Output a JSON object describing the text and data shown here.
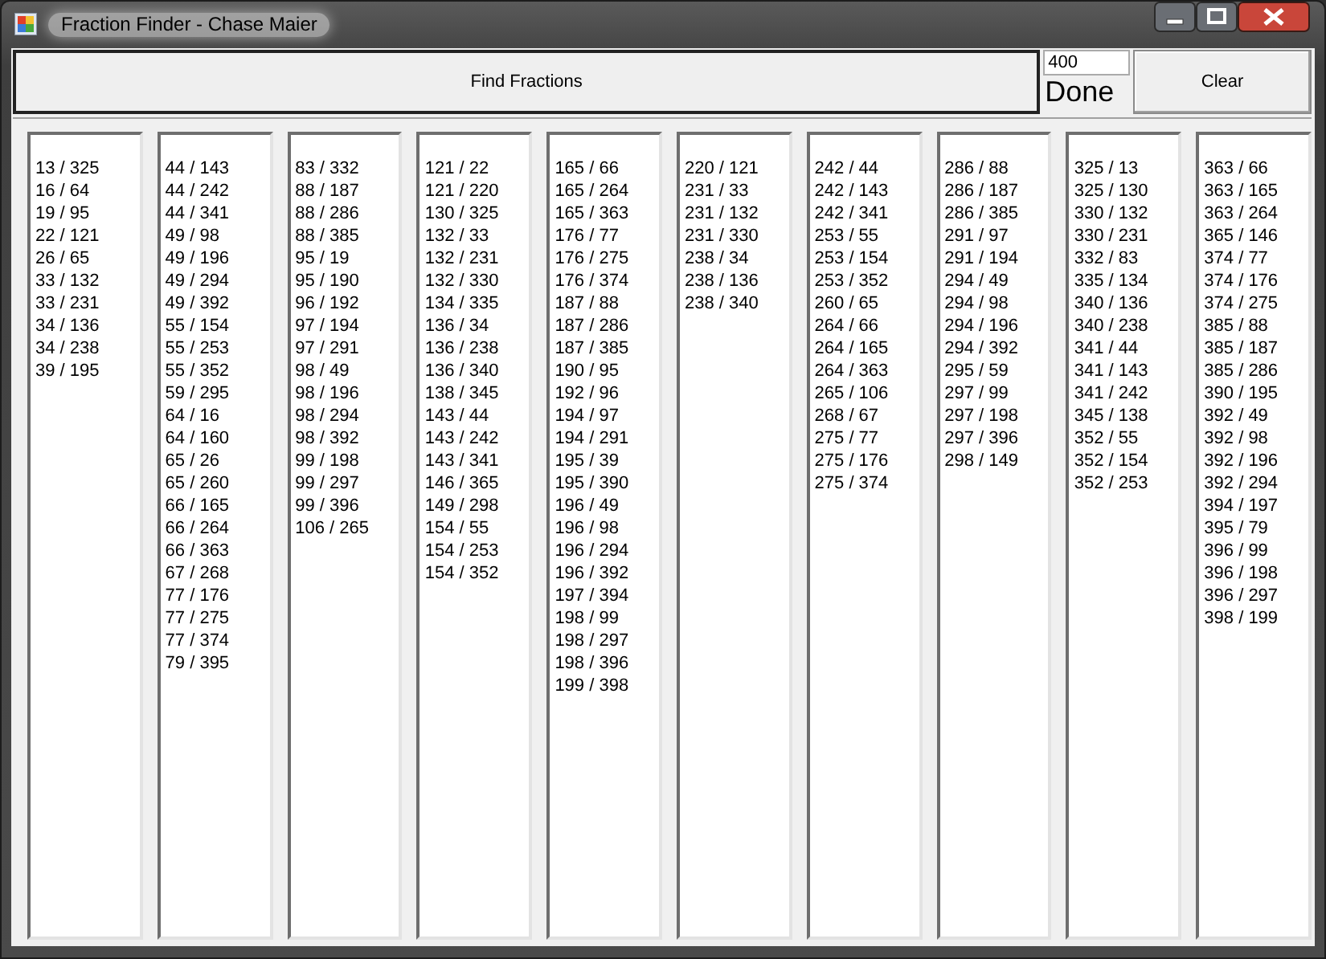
{
  "window": {
    "title": "Fraction Finder - Chase Maier"
  },
  "find_button": "Find Fractions",
  "limit_field": {
    "value": "400"
  },
  "status": "Done",
  "clear_button": "Clear",
  "lists": [
    [
      "13 / 325",
      "16 / 64",
      "19 / 95",
      "22 / 121",
      "26 / 65",
      "33 / 132",
      "33 / 231",
      "34 / 136",
      "34 / 238",
      "39 / 195"
    ],
    [
      "44 / 143",
      "44 / 242",
      "44 / 341",
      "49 / 98",
      "49 / 196",
      "49 / 294",
      "49 / 392",
      "55 / 154",
      "55 / 253",
      "55 / 352",
      "59 / 295",
      "64 / 16",
      "64 / 160",
      "65 / 26",
      "65 / 260",
      "66 / 165",
      "66 / 264",
      "66 / 363",
      "67 / 268",
      "77 / 176",
      "77 / 275",
      "77 / 374",
      "79 / 395"
    ],
    [
      "83 / 332",
      "88 / 187",
      "88 / 286",
      "88 / 385",
      "95 / 19",
      "95 / 190",
      "96 / 192",
      "97 / 194",
      "97 / 291",
      "98 / 49",
      "98 / 196",
      "98 / 294",
      "98 / 392",
      "99 / 198",
      "99 / 297",
      "99 / 396",
      "106 / 265"
    ],
    [
      "121 / 22",
      "121 / 220",
      "130 / 325",
      "132 / 33",
      "132 / 231",
      "132 / 330",
      "134 / 335",
      "136 / 34",
      "136 / 238",
      "136 / 340",
      "138 / 345",
      "143 / 44",
      "143 / 242",
      "143 / 341",
      "146 / 365",
      "149 / 298",
      "154 / 55",
      "154 / 253",
      "154 / 352"
    ],
    [
      "165 / 66",
      "165 / 264",
      "165 / 363",
      "176 / 77",
      "176 / 275",
      "176 / 374",
      "187 / 88",
      "187 / 286",
      "187 / 385",
      "190 / 95",
      "192 / 96",
      "194 / 97",
      "194 / 291",
      "195 / 39",
      "195 / 390",
      "196 / 49",
      "196 / 98",
      "196 / 294",
      "196 / 392",
      "197 / 394",
      "198 / 99",
      "198 / 297",
      "198 / 396",
      "199 / 398"
    ],
    [
      "220 / 121",
      "231 / 33",
      "231 / 132",
      "231 / 330",
      "238 / 34",
      "238 / 136",
      "238 / 340"
    ],
    [
      "242 / 44",
      "242 / 143",
      "242 / 341",
      "253 / 55",
      "253 / 154",
      "253 / 352",
      "260 / 65",
      "264 / 66",
      "264 / 165",
      "264 / 363",
      "265 / 106",
      "268 / 67",
      "275 / 77",
      "275 / 176",
      "275 / 374"
    ],
    [
      "286 / 88",
      "286 / 187",
      "286 / 385",
      "291 / 97",
      "291 / 194",
      "294 / 49",
      "294 / 98",
      "294 / 196",
      "294 / 392",
      "295 / 59",
      "297 / 99",
      "297 / 198",
      "297 / 396",
      "298 / 149"
    ],
    [
      "325 / 13",
      "325 / 130",
      "330 / 132",
      "330 / 231",
      "332 / 83",
      "335 / 134",
      "340 / 136",
      "340 / 238",
      "341 / 44",
      "341 / 143",
      "341 / 242",
      "345 / 138",
      "352 / 55",
      "352 / 154",
      "352 / 253"
    ],
    [
      "363 / 66",
      "363 / 165",
      "363 / 264",
      "365 / 146",
      "374 / 77",
      "374 / 176",
      "374 / 275",
      "385 / 88",
      "385 / 187",
      "385 / 286",
      "390 / 195",
      "392 / 49",
      "392 / 98",
      "392 / 196",
      "392 / 294",
      "394 / 197",
      "395 / 79",
      "396 / 99",
      "396 / 198",
      "396 / 297",
      "398 / 199"
    ]
  ]
}
